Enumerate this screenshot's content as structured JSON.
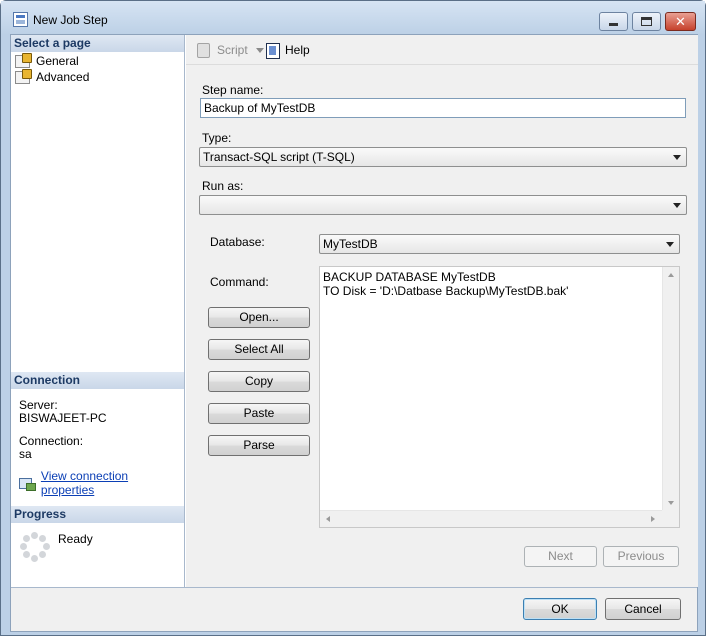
{
  "window": {
    "title": "New Job Step"
  },
  "left": {
    "select_page_header": "Select a page",
    "pages": [
      {
        "label": "General",
        "icon": "page-settings-icon",
        "selected": true
      },
      {
        "label": "Advanced",
        "icon": "page-settings-icon",
        "selected": false
      }
    ],
    "connection_header": "Connection",
    "server_label": "Server:",
    "server_value": "BISWAJEET-PC",
    "connection_label": "Connection:",
    "connection_value": "sa",
    "view_properties_link": "View connection properties",
    "progress_header": "Progress",
    "progress_status": "Ready"
  },
  "toolbar": {
    "script_label": "Script",
    "help_label": "Help"
  },
  "form": {
    "step_name_label": "Step name:",
    "step_name_value": "Backup of MyTestDB",
    "type_label": "Type:",
    "type_value": "Transact-SQL script (T-SQL)",
    "run_as_label": "Run as:",
    "run_as_value": "",
    "database_label": "Database:",
    "database_value": "MyTestDB",
    "command_label": "Command:",
    "command_text": "BACKUP DATABASE MyTestDB\nTO Disk = 'D:\\Datbase Backup\\MyTestDB.bak'"
  },
  "buttons": {
    "open": "Open...",
    "select_all": "Select All",
    "copy": "Copy",
    "paste": "Paste",
    "parse": "Parse",
    "next": "Next",
    "previous": "Previous",
    "ok": "OK",
    "cancel": "Cancel"
  },
  "colors": {
    "section_header_text": "#1d3a64",
    "link": "#0b3fb5",
    "window_frame": "#bcd0e6"
  }
}
